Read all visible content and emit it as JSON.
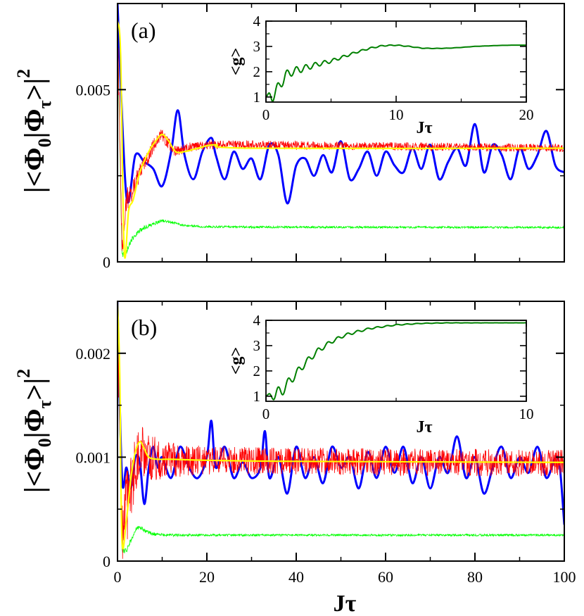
{
  "chart_data": [
    {
      "panel": "a",
      "type": "line",
      "panel_label": "(a)",
      "xlabel": "",
      "ylabel_parts": {
        "lead": "|<Φ",
        "sub1": "0",
        "mid": "|Φ",
        "sub2": "τ",
        "tail": ">|",
        "sup": "2"
      },
      "xlim": [
        0,
        100
      ],
      "ylim": [
        0,
        0.0075
      ],
      "xticks": [
        0,
        20,
        40,
        60,
        80,
        100
      ],
      "xtick_labels_shown": false,
      "yticks": [
        0,
        0.005
      ],
      "ytick_labels": [
        "0",
        "0.005"
      ],
      "series": [
        {
          "color": "#0000ff",
          "style": "smooth-oscillating",
          "x": [
            0,
            2,
            4,
            6,
            8,
            10,
            12,
            13.5,
            15,
            17,
            19,
            21,
            22,
            24,
            26,
            28,
            30,
            32,
            34,
            36,
            38,
            40,
            42,
            44,
            46,
            48,
            50,
            52,
            54,
            56,
            58,
            60,
            62,
            64,
            66,
            68,
            70,
            72,
            74,
            76,
            78,
            80,
            82,
            84,
            86,
            88,
            90,
            92,
            94,
            96,
            98,
            100
          ],
          "y": [
            0.0075,
            0.0019,
            0.0031,
            0.0029,
            0.0027,
            0.0022,
            0.0032,
            0.0044,
            0.0031,
            0.0024,
            0.0032,
            0.0036,
            0.0031,
            0.0024,
            0.0032,
            0.0027,
            0.003,
            0.0024,
            0.0034,
            0.0031,
            0.0017,
            0.0028,
            0.003,
            0.0025,
            0.0031,
            0.0026,
            0.0035,
            0.0024,
            0.0027,
            0.0032,
            0.0025,
            0.0032,
            0.0028,
            0.0026,
            0.0033,
            0.0027,
            0.0034,
            0.0024,
            0.0029,
            0.0033,
            0.0028,
            0.004,
            0.0026,
            0.0034,
            0.0031,
            0.0024,
            0.0033,
            0.0027,
            0.0031,
            0.0038,
            0.0028,
            0.0026
          ]
        },
        {
          "color": "#ff0000",
          "style": "noisy",
          "mean_x": [
            0,
            1,
            2,
            3,
            5,
            7,
            9,
            10,
            11,
            13,
            15,
            20,
            30,
            100
          ],
          "mean_y": [
            0.007,
            0.0004,
            0.0018,
            0.002,
            0.0026,
            0.0031,
            0.0036,
            0.0037,
            0.0035,
            0.0032,
            0.0033,
            0.0034,
            0.0034,
            0.0033
          ],
          "noise": 0.00012
        },
        {
          "color": "#ffff00",
          "style": "smooth",
          "x": [
            0,
            0.7,
            1.5,
            2.5,
            3.5,
            5,
            7,
            8.5,
            10,
            11.5,
            13,
            15,
            18,
            22,
            30,
            100
          ],
          "y": [
            0.007,
            0.006,
            0.0003,
            0.0015,
            0.0018,
            0.0026,
            0.0032,
            0.0035,
            0.0037,
            0.0035,
            0.0032,
            0.0032,
            0.0033,
            0.0034,
            0.0033,
            0.0033
          ]
        },
        {
          "color": "#00ff00",
          "style": "noisy",
          "mean_x": [
            0,
            1,
            2,
            3,
            4,
            6,
            8,
            10,
            12,
            15,
            20,
            30,
            100
          ],
          "mean_y": [
            0.007,
            0.0002,
            0.0003,
            0.0006,
            0.0008,
            0.001,
            0.0011,
            0.0012,
            0.00115,
            0.00105,
            0.00102,
            0.00101,
            0.001
          ],
          "noise": 3e-05
        }
      ],
      "inset": {
        "type": "line",
        "xlabel": "Jτ",
        "ylabel": "<g>",
        "xlim": [
          0,
          20
        ],
        "ylim": [
          0.8,
          4
        ],
        "xticks": [
          0,
          10,
          20
        ],
        "yticks": [
          1,
          2,
          3,
          4
        ],
        "color": "#008000",
        "osc_amp": 0.28,
        "osc_period": 0.72,
        "osc_decay": 3.5,
        "x": [
          0,
          0.5,
          1,
          1.5,
          2,
          3,
          4,
          5,
          6,
          7,
          8,
          9,
          10,
          11,
          12,
          13,
          14,
          15,
          16,
          17,
          18,
          19,
          20
        ],
        "y": [
          1.0,
          1.05,
          1.4,
          1.85,
          2.0,
          2.15,
          2.3,
          2.42,
          2.6,
          2.78,
          2.93,
          3.03,
          3.05,
          3.0,
          2.93,
          2.92,
          2.93,
          2.96,
          3.0,
          3.02,
          3.04,
          3.05,
          3.05
        ]
      }
    },
    {
      "panel": "b",
      "type": "line",
      "panel_label": "(b)",
      "xlabel": "Jτ",
      "ylabel_parts": {
        "lead": "|<Φ",
        "sub1": "0",
        "mid": "|Φ",
        "sub2": "τ",
        "tail": ">|",
        "sup": "2"
      },
      "xlim": [
        0,
        100
      ],
      "ylim": [
        0,
        0.0025
      ],
      "xticks": [
        0,
        20,
        40,
        60,
        80,
        100
      ],
      "xtick_labels": [
        "0",
        "20",
        "40",
        "60",
        "80",
        "100"
      ],
      "yticks": [
        0,
        0.001,
        0.002
      ],
      "ytick_labels": [
        "0",
        "0.001",
        "0.002"
      ],
      "series": [
        {
          "color": "#0000ff",
          "style": "smooth-oscillating",
          "x": [
            0,
            1,
            2,
            3,
            4,
            5,
            6,
            7,
            8,
            9,
            10,
            12,
            14,
            16,
            18,
            20,
            21,
            22,
            24,
            26,
            28,
            30,
            32,
            33,
            34,
            36,
            38,
            40,
            42,
            44,
            46,
            48,
            50,
            52,
            54,
            56,
            58,
            60,
            62,
            64,
            66,
            68,
            70,
            72,
            74,
            76,
            78,
            80,
            82,
            84,
            86,
            88,
            90,
            92,
            94,
            96,
            98,
            99,
            100
          ],
          "y": [
            0.0025,
            0.0008,
            0.0009,
            0.0007,
            0.001,
            0.00095,
            0.00055,
            0.0009,
            0.0011,
            0.0009,
            0.001,
            0.0008,
            0.0011,
            0.0009,
            0.0008,
            0.001,
            0.00135,
            0.0009,
            0.0011,
            0.0008,
            0.00095,
            0.0008,
            0.0009,
            0.00125,
            0.0008,
            0.001,
            0.00065,
            0.0011,
            0.0008,
            0.001,
            0.00075,
            0.0011,
            0.0009,
            0.001,
            0.0007,
            0.00105,
            0.0008,
            0.0011,
            0.00085,
            0.0011,
            0.00075,
            0.001,
            0.0007,
            0.001,
            0.00085,
            0.0012,
            0.0008,
            0.001,
            0.00065,
            0.0009,
            0.0011,
            0.0008,
            0.001,
            0.00085,
            0.0011,
            0.0008,
            0.001,
            0.0009,
            0.00035
          ]
        },
        {
          "color": "#ff0000",
          "style": "noisy",
          "mean_x": [
            0,
            1,
            2,
            3,
            4,
            5,
            6,
            8,
            10,
            15,
            20,
            100
          ],
          "mean_y": [
            0.0024,
            0.0004,
            0.0005,
            0.0007,
            0.0009,
            0.00112,
            0.00105,
            0.00099,
            0.00098,
            0.00097,
            0.00097,
            0.00094
          ],
          "noise": 0.00013
        },
        {
          "color": "#ffff00",
          "style": "smooth",
          "x": [
            0,
            0.5,
            1,
            2,
            3,
            4,
            5,
            6,
            7,
            9,
            12,
            20,
            40,
            100
          ],
          "y": [
            0.0025,
            0.0018,
            0.0002,
            0.0004,
            0.0008,
            0.00105,
            0.00115,
            0.00108,
            0.001,
            0.00098,
            0.00098,
            0.00097,
            0.00096,
            0.00095
          ]
        },
        {
          "color": "#00ff00",
          "style": "noisy",
          "mean_x": [
            0,
            1,
            2,
            3,
            4,
            5,
            6,
            8,
            12,
            20,
            100
          ],
          "mean_y": [
            0.0024,
            0.0001,
            0.0001,
            0.0002,
            0.0003,
            0.00033,
            0.00029,
            0.00026,
            0.00025,
            0.00025,
            0.00025
          ],
          "noise": 1e-05
        }
      ],
      "inset": {
        "type": "line",
        "xlabel": "Jτ",
        "ylabel": "<g>",
        "xlim": [
          0,
          10
        ],
        "ylim": [
          0.8,
          4
        ],
        "xticks": [
          0,
          10
        ],
        "yticks": [
          1,
          2,
          3,
          4
        ],
        "color": "#008000",
        "osc_amp": 0.3,
        "osc_period": 0.38,
        "osc_decay": 1.8,
        "x": [
          0,
          0.3,
          0.6,
          1,
          1.5,
          2,
          2.5,
          3,
          3.5,
          4,
          5,
          6,
          7,
          8,
          9,
          10
        ],
        "y": [
          1.0,
          1.05,
          1.2,
          1.7,
          2.3,
          2.8,
          3.15,
          3.4,
          3.55,
          3.68,
          3.82,
          3.88,
          3.9,
          3.9,
          3.9,
          3.9
        ]
      }
    }
  ]
}
